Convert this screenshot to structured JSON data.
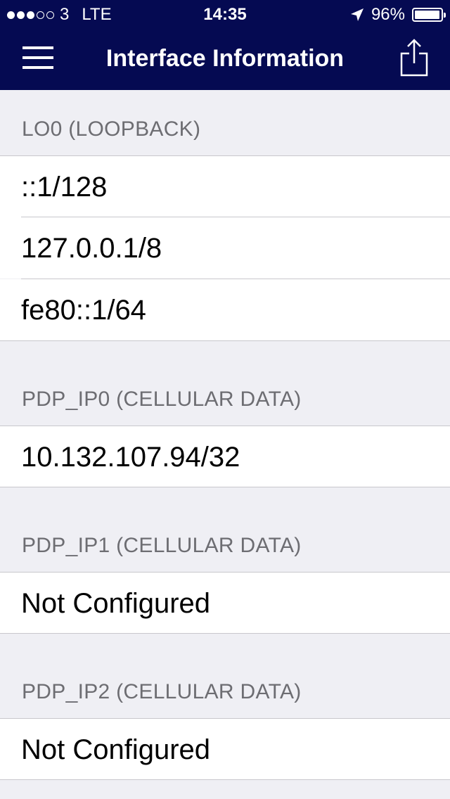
{
  "status_bar": {
    "carrier": "3",
    "network": "LTE",
    "time": "14:35",
    "battery_percent": "96%",
    "battery_level": 0.96
  },
  "nav": {
    "title": "Interface Information"
  },
  "sections": [
    {
      "header": "LO0 (LOOPBACK)",
      "rows": [
        "::1/128",
        "127.0.0.1/8",
        "fe80::1/64"
      ]
    },
    {
      "header": "PDP_IP0 (CELLULAR DATA)",
      "rows": [
        "10.132.107.94/32"
      ]
    },
    {
      "header": "PDP_IP1 (CELLULAR DATA)",
      "rows": [
        "Not Configured"
      ]
    },
    {
      "header": "PDP_IP2 (CELLULAR DATA)",
      "rows": [
        "Not Configured"
      ]
    }
  ],
  "colors": {
    "bar_background": "#050a52",
    "page_background": "#efeff4",
    "header_text": "#6d6d72",
    "separator": "#c8c7cc"
  }
}
